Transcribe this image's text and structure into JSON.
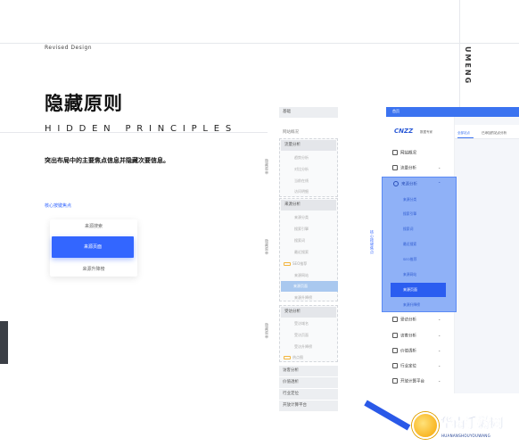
{
  "header": {
    "revised": "Revised Design",
    "brand_vertical": "UMENG",
    "title_cn": "隐藏原则",
    "title_en": "HIDDEN PRINCIPLES",
    "subtitle": "突出布局中的主要焦点信息并隐藏次要信息。",
    "link_label": "核心按键焦点"
  },
  "demo_card": {
    "items": [
      "来源搜索",
      "来源页面",
      "来源升降榜"
    ],
    "selected_index": 1
  },
  "middle_menu": {
    "top_head": "基础",
    "group1": {
      "head": "网站概况",
      "subhead": "流量分析",
      "items": [
        "趋势分析",
        "对比分析",
        "当前在线",
        "访问明细"
      ]
    },
    "group2": {
      "head": "来源分析",
      "items": [
        "来源分类",
        "搜索引擎",
        "搜索词",
        "最近搜索",
        "SEO推荐",
        "来源网站",
        "来源页面",
        "来源升降榜"
      ],
      "tag_item_index": 4,
      "selected_index": 6
    },
    "group3": {
      "head": "受访分析",
      "items": [
        "受访域名",
        "受访页面",
        "受访升降榜",
        "热点图"
      ],
      "tag_item_index": 3
    },
    "bottom": [
      "访客分析",
      "价值透析",
      "行业定位",
      "开放计算平台"
    ],
    "vertical_labels": [
      "隐藏菜单",
      "隐藏菜单",
      "隐藏菜单"
    ]
  },
  "app": {
    "bar_label": "首页",
    "logo": "CNZZ",
    "logo_sub": "数据专家",
    "tabs": [
      "全部站点",
      "已添加的站点分析"
    ],
    "vertical_label": "核心按键焦点",
    "nav_items": [
      "网站概况",
      "流量分析",
      "来源分析",
      "受访分析",
      "访客分析",
      "价值透析",
      "行业定位",
      "开放计算平台"
    ],
    "expanded_index": 2,
    "sub_items": [
      "来源分类",
      "搜索引擎",
      "搜索词",
      "最近搜索",
      "SEO推荐",
      "来源网站",
      "来源页面",
      "来源升降榜"
    ],
    "sub_selected_index": 6
  },
  "watermark": {
    "text": "华南手游网",
    "sub": "HUANANSHOUYOUWANG"
  },
  "colors": {
    "accent": "#3366ff",
    "app_blue": "#3b73f0",
    "highlight_light": "#8fb1f7"
  }
}
